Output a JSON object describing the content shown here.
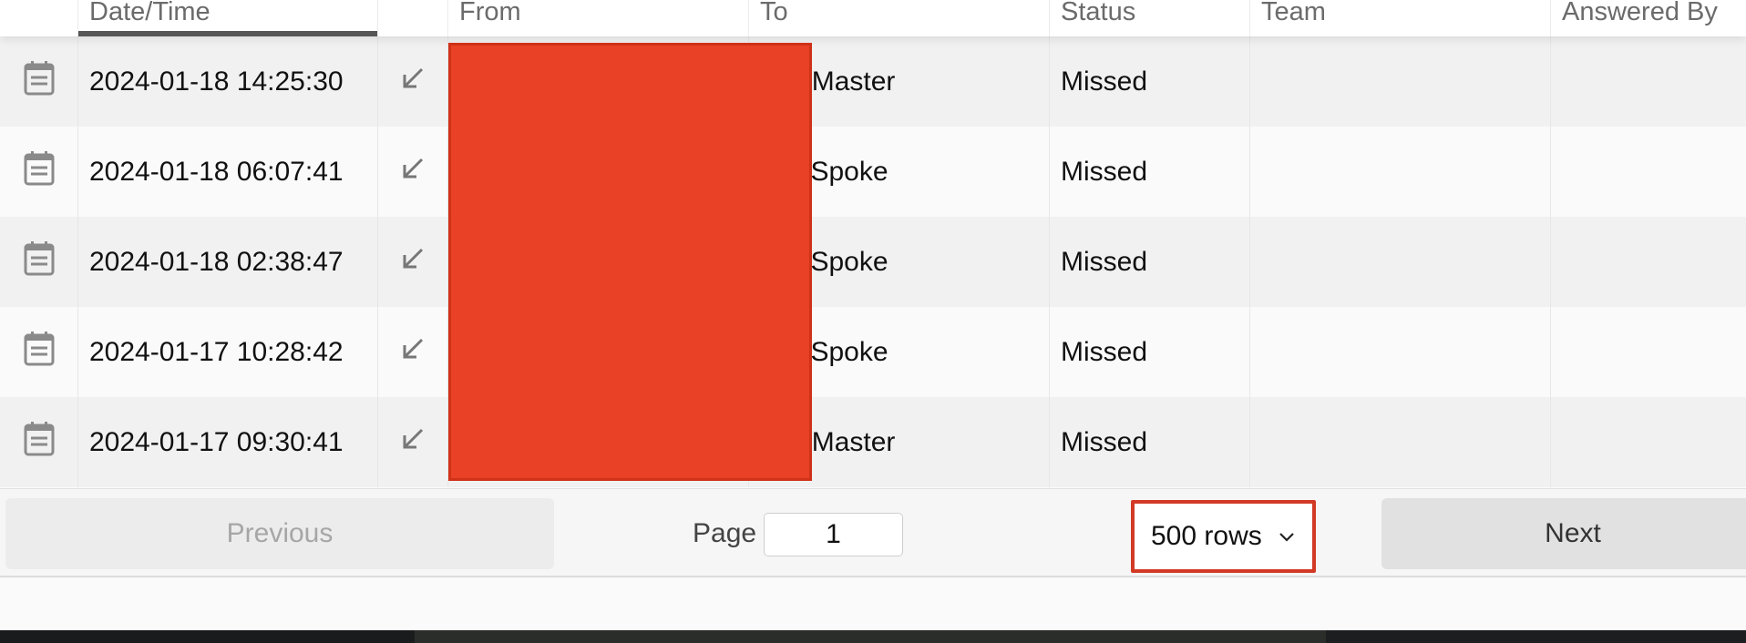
{
  "header": {
    "columns": [
      {
        "label": ""
      },
      {
        "label": "Date/Time"
      },
      {
        "label": ""
      },
      {
        "label": "From"
      },
      {
        "label": "To"
      },
      {
        "label": "Status"
      },
      {
        "label": "Team"
      },
      {
        "label": "Answered By"
      }
    ]
  },
  "rows": [
    {
      "datetime": "2024-01-18 14:25:30",
      "to": "Jun Master",
      "status": "Missed",
      "team": "",
      "answered_by": ""
    },
    {
      "datetime": "2024-01-18 06:07:41",
      "to": "o @Spoke",
      "status": "Missed",
      "team": "",
      "answered_by": ""
    },
    {
      "datetime": "2024-01-18 02:38:47",
      "to": "o @Spoke",
      "status": "Missed",
      "team": "",
      "answered_by": ""
    },
    {
      "datetime": "2024-01-17 10:28:42",
      "to": "o @Spoke",
      "status": "Missed",
      "team": "",
      "answered_by": ""
    },
    {
      "datetime": "2024-01-17 09:30:41",
      "to": "Jun Master",
      "status": "Missed",
      "team": "",
      "answered_by": ""
    }
  ],
  "icons": {
    "row_detail": "note-calendar-icon",
    "direction": "incoming-call-arrow-icon",
    "select_chevron": "chevron-down-icon"
  },
  "pagination": {
    "previous_label": "Previous",
    "page_label": "Page",
    "page_value": "1",
    "rows_selected": "500 rows",
    "next_label": "Next"
  },
  "colors": {
    "redaction": "#e84126",
    "highlight_border": "#d23a26",
    "sort_indicator": "#555555"
  }
}
